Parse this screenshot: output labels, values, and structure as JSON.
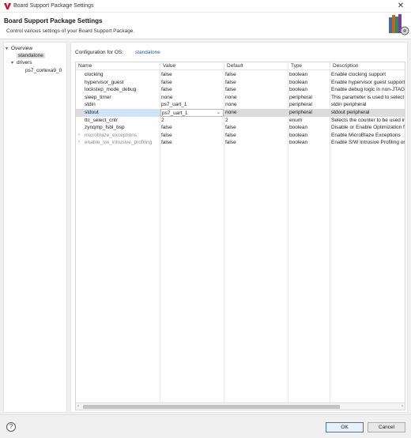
{
  "window": {
    "title": "Board Support Package Settings",
    "close_glyph": "✕"
  },
  "header": {
    "title": "Board Support Package Settings",
    "description": "Control various settings of your Board Support Package.",
    "icon": "books-icon"
  },
  "tree": {
    "items": [
      {
        "label": "Overview",
        "arrow": "▾"
      },
      {
        "label": "standalone",
        "selected": true
      },
      {
        "label": "drivers",
        "arrow": "▾"
      },
      {
        "label": "ps7_cortexa9_0"
      }
    ]
  },
  "config": {
    "label": "Configuration for OS:",
    "os_link": "standalone"
  },
  "table": {
    "columns": [
      "Name",
      "Value",
      "Default",
      "Type",
      "Description"
    ],
    "rows": [
      {
        "name": "clocking",
        "value": "false",
        "default": "false",
        "type": "boolean",
        "description": "Enable clocking support"
      },
      {
        "name": "hypervisor_guest",
        "value": "false",
        "default": "false",
        "type": "boolean",
        "description": "Enable hypervisor guest support"
      },
      {
        "name": "lockstep_mode_debug",
        "value": "false",
        "default": "false",
        "type": "boolean",
        "description": "Enable debug logic in non-JTAG"
      },
      {
        "name": "sleep_timer",
        "value": "none",
        "default": "none",
        "type": "peripheral",
        "description": "This parameter is used to select"
      },
      {
        "name": "stdin",
        "value": "ps7_uart_1",
        "default": "none",
        "type": "peripheral",
        "description": "stdin peripheral"
      },
      {
        "name": "stdout",
        "value": "ps7_uart_1",
        "default": "none",
        "type": "peripheral",
        "description": "stdout peripheral",
        "selected": true
      },
      {
        "name": "ttc_select_cntr",
        "value": "2",
        "default": "2",
        "type": "enum",
        "description": "Selects the counter to be used in"
      },
      {
        "name": "zynqmp_fsbl_bsp",
        "value": "false",
        "default": "false",
        "type": "boolean",
        "description": "Disable or Enable Optimization f"
      },
      {
        "name": "microblaze_exceptions",
        "value": "false",
        "default": "false",
        "type": "boolean",
        "description": "Enable MicroBlaze Exceptions",
        "expandable": true,
        "dim": true
      },
      {
        "name": "enable_sw_intrusive_profiling",
        "value": "false",
        "default": "false",
        "type": "boolean",
        "description": "Enable S/W Intrusive Profiling or",
        "expandable": true,
        "dim": true
      }
    ]
  },
  "footer": {
    "help_glyph": "?",
    "ok_label": "OK",
    "cancel_label": "Cancel"
  },
  "colors": {
    "link": "#1a5aa6",
    "selected_row": "#dcdcdc",
    "selected_name_cell": "#cfe4f7",
    "ok_border": "#3478c6"
  }
}
